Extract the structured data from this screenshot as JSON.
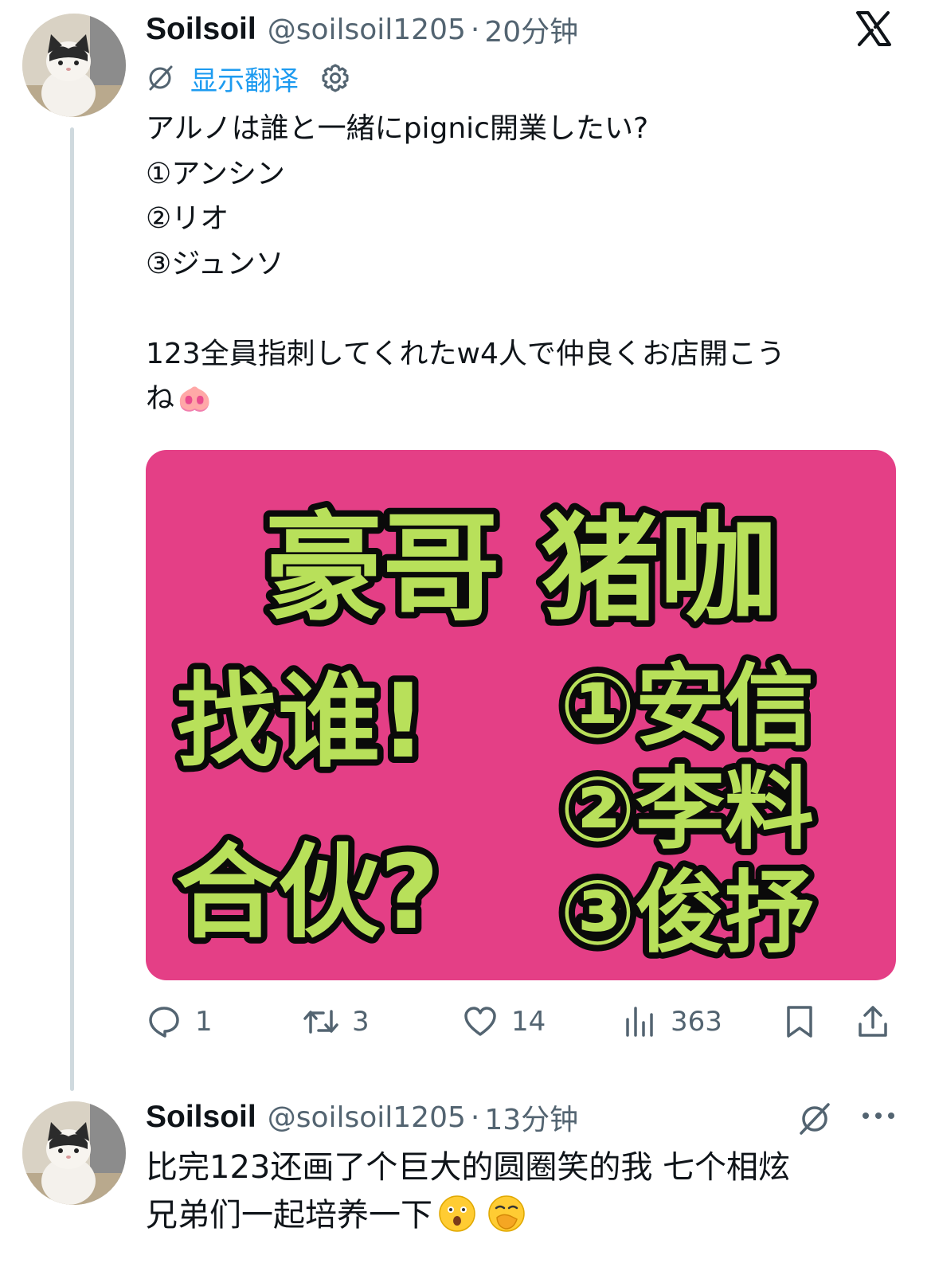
{
  "tweet": {
    "author_name": "Soilsoil",
    "handle": "@soilsoil1205",
    "separator": "·",
    "time": "20分钟",
    "translate_label": "显示翻译",
    "text_main": "アルノは誰と一緒にpignic開業したい?\n①アンシン\n②リオ\n③ジュンソ\n\n123全員指刺してくれたw4人で仲良くお店開こう\nね",
    "text_emoji": "🐽",
    "image_lines": [
      "豪哥 猪咖",
      "找谁!",
      "合伙?",
      "①安信",
      "②李料",
      "③俊抒"
    ],
    "image_colors": {
      "background": "#e43f86",
      "text": "#b8e05a",
      "outline": "#0a0a0a"
    },
    "actions": {
      "reply_count": "1",
      "retweet_count": "3",
      "like_count": "14",
      "views_count": "363"
    }
  },
  "reply": {
    "author_name": "Soilsoil",
    "handle": "@soilsoil1205",
    "separator": "·",
    "time": "13分钟",
    "text": "比完123还画了个巨大的圆圈笑的我 七个相炫\n兄弟们一起培养一下"
  },
  "icons": [
    "x-logo-icon",
    "translate-icon",
    "gear-icon",
    "reply-icon",
    "retweet-icon",
    "like-icon",
    "views-icon",
    "bookmark-icon",
    "share-icon",
    "grok-icon",
    "more-icon"
  ],
  "colors": {
    "link": "#1d9bf0",
    "muted": "#536471",
    "text": "#0f1419",
    "thread": "#cfd9de"
  }
}
